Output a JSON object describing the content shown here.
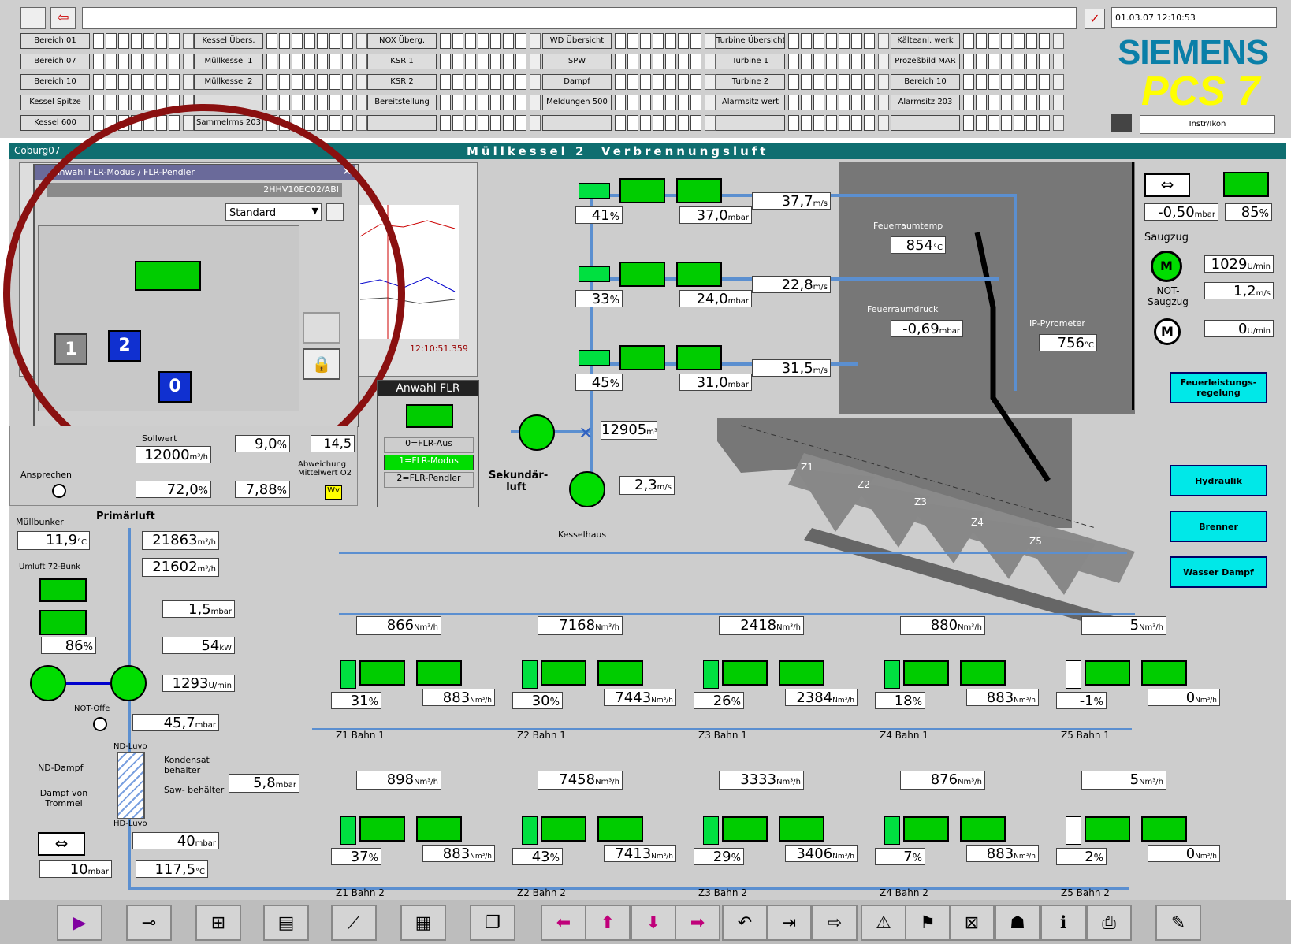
{
  "header": {
    "datetime": "01.03.07 12:10:53",
    "brand": "SIEMENS",
    "product": "PCS 7",
    "login": "Instr/Ikon",
    "rows": [
      [
        "Bereich 01",
        "Kessel Übers.",
        "NOX Überg.",
        "WD Übersicht",
        "Turbine Übersicht",
        "Kälteanl. werk"
      ],
      [
        "Bereich 07",
        "Müllkessel 1",
        "KSR 1",
        "SPW",
        "Turbine 1",
        "Prozeßbild MAR"
      ],
      [
        "Bereich 10",
        "Müllkessel 2",
        "KSR 2",
        "Dampf",
        "Turbine 2",
        "Bereich 10"
      ],
      [
        "Kessel Spitze",
        "",
        "Bereitstellung",
        "Meldungen 500",
        "Alarmsitz wert",
        "Alarmsitz 203"
      ],
      [
        "Kessel 600",
        "Sammelrms 203",
        "",
        "",
        "",
        ""
      ]
    ]
  },
  "title_bar": {
    "left": "Coburg07",
    "title": "Müllkessel 2  Verbrennungsluft"
  },
  "faceplate": {
    "title": "Anwahl FLR-Modus / FLR-Pendler",
    "tag": "2HHV10EC02/ABI",
    "view_select": "Standard",
    "btn1": "1",
    "btn2": "2",
    "btn0": "0",
    "trend_time": "12:10:51.359"
  },
  "panel_left": {
    "ansprechen": "Ansprechen",
    "sollwert_label": "Sollwert",
    "sollwert": "12000",
    "sollwert_unit": "m³/h",
    "ausgang": "72,0",
    "ausgang_unit": "%",
    "pct1": "9,0",
    "pct1_unit": "%",
    "pct2": "7,88",
    "pct2_unit": "%",
    "pct3": "14,5",
    "abweichung": "Abweichung Mittelwert O2",
    "wv": "Wv"
  },
  "anwahl": {
    "title": "Anwahl FLR",
    "opt0": "0=FLR-Aus",
    "opt1": "1=FLR-Modus",
    "opt2": "2=FLR-Pendler"
  },
  "top_dampers": [
    {
      "pct": "41",
      "mbar": "37,0",
      "flow": "37,7"
    },
    {
      "pct": "33",
      "mbar": "24,0",
      "flow": "22,8"
    },
    {
      "pct": "45",
      "mbar": "31,0",
      "flow": "31,5"
    }
  ],
  "units": {
    "pct": "%",
    "mbar": "mbar",
    "m3h": "m³/h",
    "nm3h": "Nm³/h",
    "degc": "°C",
    "umin": "U/min",
    "ms": "m/s",
    "kw": "kW"
  },
  "furnace": {
    "temp_label": "Feuerraumtemp",
    "temp": "854",
    "pressure_label": "Feuerraumdruck",
    "pressure": "-0,69",
    "pressure_unit": "mbar",
    "ip_label": "IP-Pyrometer",
    "ip": "756",
    "zones": [
      "Z1",
      "Z2",
      "Z3",
      "Z4",
      "Z5"
    ]
  },
  "sekundaer": {
    "label": "Sekundär- luft",
    "flow": "12905",
    "speed": "2,3",
    "kesselhaus": "Kesselhaus"
  },
  "right_panel": {
    "pressure": "-0,50",
    "pct": "85",
    "saugzug": "Saugzug",
    "rpm": "1029",
    "not_label": "NOT- Saugzug",
    "not_speed": "1,2",
    "not_unit": "m/s",
    "not_rpm": "0",
    "btn_feuer": "Feuerleistungs- regelung",
    "btn_hydraulik": "Hydraulik",
    "btn_brenner": "Brenner",
    "btn_wasser": "Wasser Dampf"
  },
  "primaer": {
    "label": "Primärluft",
    "bunker_label": "Müllbunker",
    "bunker_temp": "11,9",
    "flow1": "21863",
    "flow2": "21602",
    "umluft_label": "Umluft 72-Bunk",
    "mbar": "1,5",
    "pct": "86",
    "kw": "54",
    "rpm": "1293",
    "not_label": "NOT-Öffe",
    "p1": "45,7",
    "luvo_top": "ND-Luvo",
    "nd_dampf": "ND-Dampf",
    "dampf_trommel": "Dampf von Trommel",
    "kondensat": "Kondensat behälter",
    "sawbehaelter": "Saw- behälter",
    "hd_luvo": "HD-Luvo",
    "p2": "5,8",
    "p3": "40",
    "p4": "10",
    "temp2": "117,5"
  },
  "zones_row1": [
    {
      "label": "Z1 Bahn 1",
      "flow": "866",
      "pct": "31",
      "out": "883"
    },
    {
      "label": "Z2 Bahn 1",
      "flow": "7168",
      "pct": "30",
      "out": "7443"
    },
    {
      "label": "Z3 Bahn 1",
      "flow": "2418",
      "pct": "26",
      "out": "2384"
    },
    {
      "label": "Z4 Bahn 1",
      "flow": "880",
      "pct": "18",
      "out": "883"
    },
    {
      "label": "Z5 Bahn 1",
      "flow": "5",
      "pct": "-1",
      "out": "0"
    }
  ],
  "zones_row2": [
    {
      "label": "Z1 Bahn 2",
      "flow": "898",
      "pct": "37",
      "out": "883"
    },
    {
      "label": "Z2 Bahn 2",
      "flow": "7458",
      "pct": "43",
      "out": "7413"
    },
    {
      "label": "Z3 Bahn 2",
      "flow": "3333",
      "pct": "29",
      "out": "3406"
    },
    {
      "label": "Z4 Bahn 2",
      "flow": "876",
      "pct": "7",
      "out": "883"
    },
    {
      "label": "Z5 Bahn 2",
      "flow": "5",
      "pct": "2",
      "out": "0"
    }
  ],
  "toolbar": [
    "play-icon",
    "plug-icon",
    "hierarchy-icon",
    "picture-icon",
    "trend-icon",
    "report-icon",
    "copy-icon",
    "arrow-left-icon",
    "arrow-up-icon",
    "arrow-down-icon",
    "arrow-right-icon",
    "back-icon",
    "next-icon",
    "forward-icon",
    "alarm1-icon",
    "alarm2-icon",
    "alarm3-icon",
    "user-icon",
    "info-icon",
    "printer-icon",
    "log-icon"
  ]
}
